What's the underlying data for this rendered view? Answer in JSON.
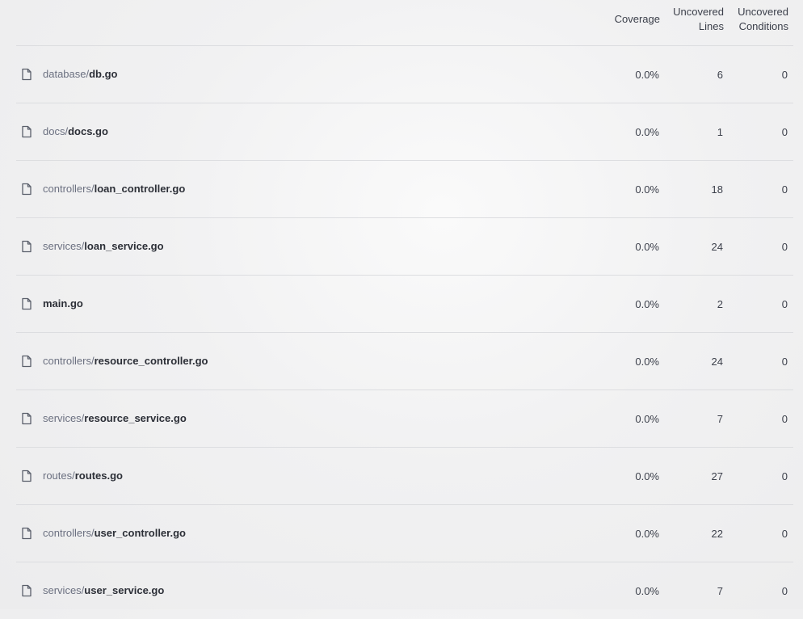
{
  "columns": {
    "coverage": "Coverage",
    "uncovered_lines_1": "Uncovered",
    "uncovered_lines_2": "Lines",
    "uncovered_conditions_1": "Uncovered",
    "uncovered_conditions_2": "Conditions"
  },
  "rows": [
    {
      "dir": "database/",
      "file": "db.go",
      "coverage": "0.0%",
      "lines": "6",
      "conditions": "0"
    },
    {
      "dir": "docs/",
      "file": "docs.go",
      "coverage": "0.0%",
      "lines": "1",
      "conditions": "0"
    },
    {
      "dir": "controllers/",
      "file": "loan_controller.go",
      "coverage": "0.0%",
      "lines": "18",
      "conditions": "0"
    },
    {
      "dir": "services/",
      "file": "loan_service.go",
      "coverage": "0.0%",
      "lines": "24",
      "conditions": "0"
    },
    {
      "dir": "",
      "file": "main.go",
      "coverage": "0.0%",
      "lines": "2",
      "conditions": "0"
    },
    {
      "dir": "controllers/",
      "file": "resource_controller.go",
      "coverage": "0.0%",
      "lines": "24",
      "conditions": "0"
    },
    {
      "dir": "services/",
      "file": "resource_service.go",
      "coverage": "0.0%",
      "lines": "7",
      "conditions": "0"
    },
    {
      "dir": "routes/",
      "file": "routes.go",
      "coverage": "0.0%",
      "lines": "27",
      "conditions": "0"
    },
    {
      "dir": "controllers/",
      "file": "user_controller.go",
      "coverage": "0.0%",
      "lines": "22",
      "conditions": "0"
    },
    {
      "dir": "services/",
      "file": "user_service.go",
      "coverage": "0.0%",
      "lines": "7",
      "conditions": "0"
    }
  ],
  "icons": {
    "file": "file-icon"
  }
}
